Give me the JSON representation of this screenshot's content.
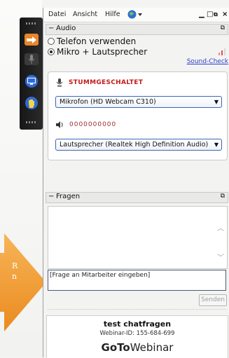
{
  "menu": {
    "file": "Datei",
    "view": "Ansicht",
    "help": "Hilfe"
  },
  "audio": {
    "header": "Audio",
    "option_phone": "Telefon verwenden",
    "option_mic": "Mikro + Lautsprecher",
    "sound_check": "Sound-Check",
    "muted_label": "STUMMGESCHALTET",
    "microphone_value": "Mikrofon (HD Webcam C310)",
    "speaker_level": "0000000000",
    "speaker_value": "Lautsprecher (Realtek High Definition Audio)"
  },
  "questions": {
    "header": "Fragen",
    "input_placeholder": "[Frage an Mitarbeiter eingeben]",
    "send_label": "Senden"
  },
  "footer": {
    "webinar_title": "test chatfragen",
    "webinar_id": "Webinar-ID: 155-684-699",
    "logo_bold": "GoTo",
    "logo_regular": "Webinar"
  },
  "arrow_text": {
    "line1": "R",
    "line2": "n"
  },
  "colors": {
    "muted_red": "#c21b1b",
    "accent_blue": "#3b66b4",
    "link_blue": "#2a3fd0",
    "toolbar_orange": "#e8872a",
    "arrow_orange": "#f2a13a"
  },
  "icons": [
    "arrow-share-icon",
    "microphone-icon",
    "screen-icon",
    "hand-raise-icon",
    "globe-icon",
    "microphone-muted-icon",
    "speaker-icon"
  ]
}
